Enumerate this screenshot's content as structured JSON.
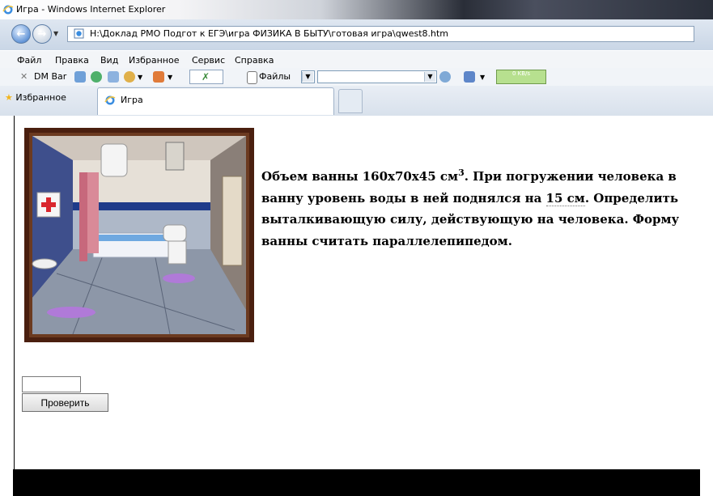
{
  "window": {
    "title": "Игра - Windows Internet Explorer"
  },
  "address": {
    "url": "H:\\Доклад РМО Подгот к ЕГЭ\\игра ФИЗИКА В БЫТУ\\готовая игра\\qwest8.htm"
  },
  "menu": {
    "items": [
      "Файл",
      "Правка",
      "Вид",
      "Избранное",
      "Сервис",
      "Справка"
    ]
  },
  "toolbar": {
    "dm_label": "DM Bar",
    "files_label": "Файлы",
    "speed": "0 KB/s"
  },
  "tabs": {
    "favorites_label": "Избранное",
    "active_tab": "Игра"
  },
  "task": {
    "part1": "Объем ванны 160х70х45 см",
    "sup": "3",
    "part2": ". При погружении человека в ванну уровень воды в ней поднялся на ",
    "highlight": "15 см",
    "part3": ". Определить выталкивающую силу, действующую на человека. Форму ванны  считать параллелепипедом."
  },
  "form": {
    "answer_value": "",
    "check_label": "Проверить"
  },
  "colors": {
    "accent": "#2d6fc7",
    "frame": "#4a1f0f"
  }
}
